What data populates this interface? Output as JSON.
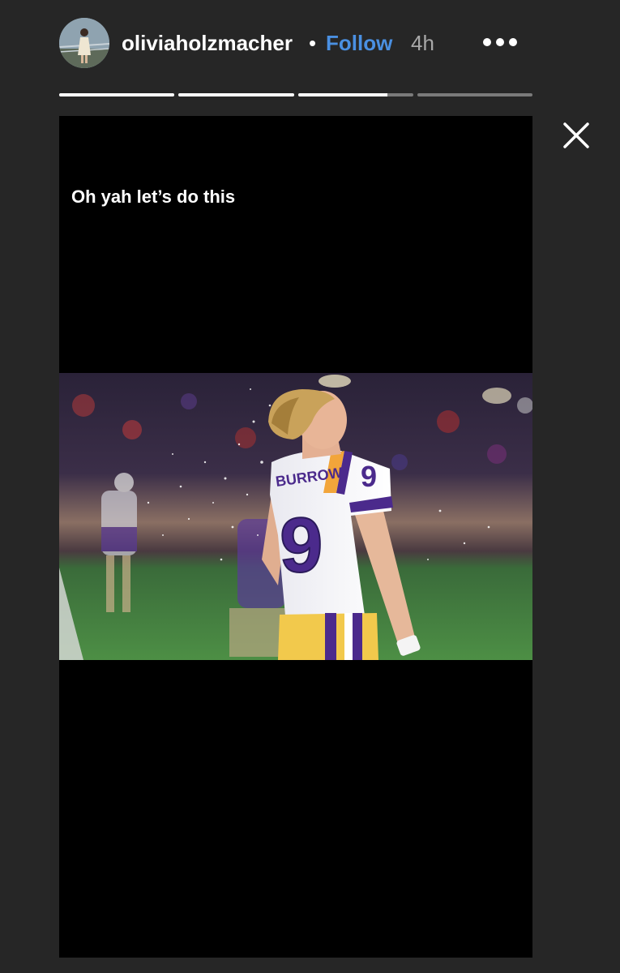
{
  "header": {
    "username": "oliviaholzmacher",
    "separator": "•",
    "follow_label": "Follow",
    "time": "4h",
    "avatar_icon": "profile-avatar",
    "more_icon": "more-options-icon"
  },
  "progress": {
    "segments": [
      1,
      1,
      0.78,
      0
    ]
  },
  "close_icon": "close-icon",
  "story": {
    "caption": "Oh yah let’s do this",
    "photo": {
      "nameplate": "BURROW",
      "jersey_number": "9"
    }
  },
  "colors": {
    "background": "#262626",
    "follow": "#4a90e2",
    "jersey_purple": "#4b2a8c",
    "jersey_gold": "#f2c94c"
  }
}
